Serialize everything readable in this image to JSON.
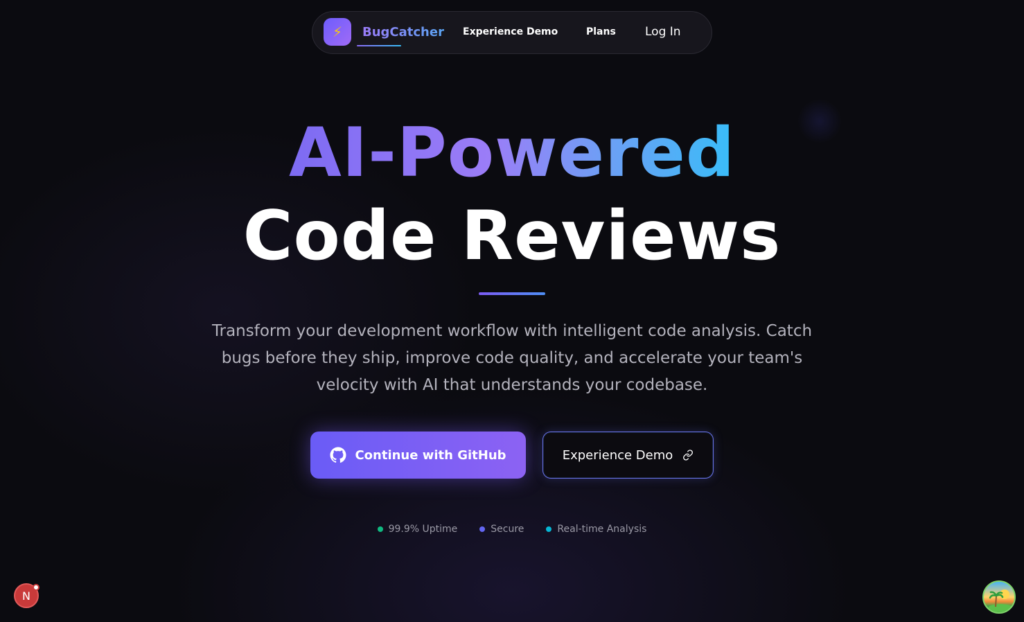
{
  "nav": {
    "brand": "BugCatcher",
    "logo_icon": "lightning-icon",
    "links": {
      "experience_demo": "Experience Demo",
      "plans": "Plans",
      "login": "Log In"
    }
  },
  "hero": {
    "title_line1": "AI-Powered",
    "title_line2": "Code Reviews",
    "subtitle": "Transform your development workflow with intelligent code analysis. Catch bugs before they ship, improve code quality, and accelerate your team's velocity with AI that understands your codebase."
  },
  "buttons": {
    "github": "Continue with GitHub",
    "github_icon": "github-icon",
    "demo": "Experience Demo",
    "demo_icon": "link-icon"
  },
  "features": [
    {
      "label": "99.9% Uptime",
      "color": "#10b981"
    },
    {
      "label": "Secure",
      "color": "#6366f1"
    },
    {
      "label": "Real-time Analysis",
      "color": "#06b6d4"
    }
  ],
  "corner": {
    "badge_letter": "N"
  },
  "colors": {
    "accent_purple": "#7c5cf4",
    "accent_blue": "#38bdf8",
    "background": "#0b0b10"
  }
}
